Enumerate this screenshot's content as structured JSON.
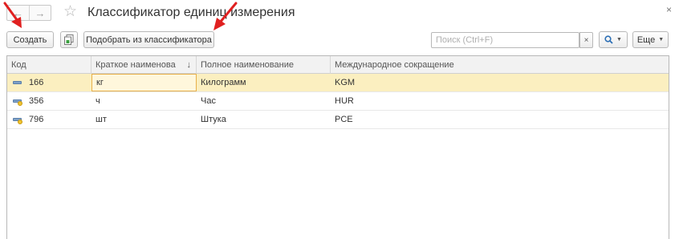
{
  "window": {
    "title": "Классификатор единиц измерения",
    "close_glyph": "×",
    "back_glyph": "←",
    "forward_glyph": "→",
    "star_glyph": "☆"
  },
  "toolbar": {
    "create_label": "Создать",
    "pick_label": "Подобрать из классификатора",
    "search_placeholder": "Поиск (Ctrl+F)",
    "search_value": "",
    "clear_glyph": "×",
    "find_glyph": "🔍",
    "more_label": "Еще",
    "caret_glyph": "▼"
  },
  "table": {
    "columns": [
      "Код",
      "Краткое наименова",
      "Полное наименование",
      "Международное сокращение"
    ],
    "sort_glyph": "↓",
    "rows": [
      {
        "code": "166",
        "short": "кг",
        "full": "Килограмм",
        "intl": "KGM",
        "icon": "unit-icon"
      },
      {
        "code": "356",
        "short": "ч",
        "full": "Час",
        "intl": "HUR",
        "icon": "unit-predefined-icon"
      },
      {
        "code": "796",
        "short": "шт",
        "full": "Штука",
        "intl": "PCE",
        "icon": "unit-predefined-icon"
      }
    ]
  },
  "colors": {
    "selected_row": "#fbefc0",
    "annotation_arrow": "#e02020"
  }
}
